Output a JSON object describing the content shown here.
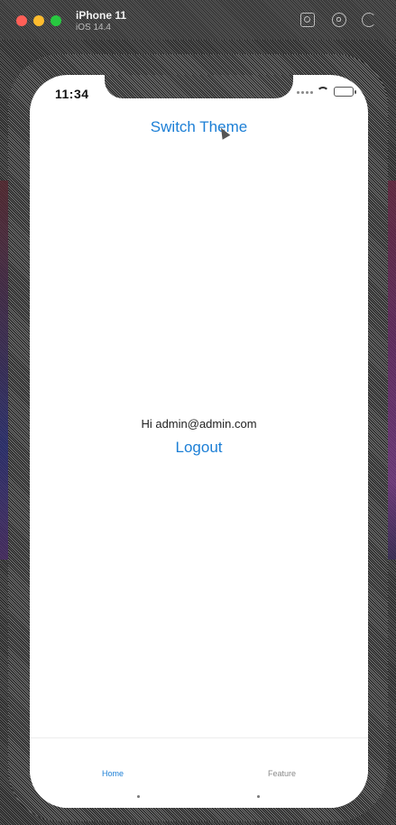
{
  "simulator": {
    "device_name": "iPhone 11",
    "device_sub": "iOS 14.4"
  },
  "status_bar": {
    "time": "11:34"
  },
  "header": {
    "switch_theme_label": "Switch Theme"
  },
  "main": {
    "greeting": "Hi admin@admin.com",
    "logout_label": "Logout"
  },
  "tabbar": {
    "tabs": [
      {
        "label": "Home",
        "active": true
      },
      {
        "label": "Feature",
        "active": false
      }
    ]
  },
  "colors": {
    "accent": "#1c7fd6",
    "inactive_tab": "#8a8a8a"
  }
}
